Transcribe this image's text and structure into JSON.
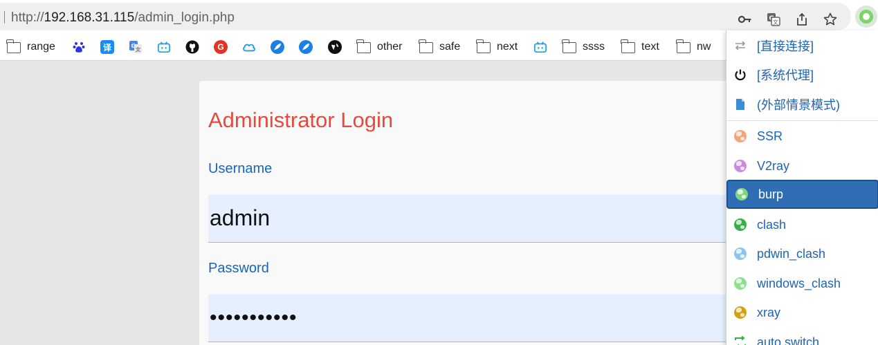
{
  "browser": {
    "url_scheme": "http://",
    "url_host": "192.168.31.115",
    "url_path": "/admin_login.php"
  },
  "bookmarks": [
    {
      "label": "range",
      "icon": "folder-icon"
    },
    {
      "label": "",
      "icon": "baidu-icon"
    },
    {
      "label": "",
      "icon": "translate-icon"
    },
    {
      "label": "",
      "icon": "google-translate-icon"
    },
    {
      "label": "",
      "icon": "bilibili-icon"
    },
    {
      "label": "",
      "icon": "github-icon"
    },
    {
      "label": "",
      "icon": "red-g-icon"
    },
    {
      "label": "",
      "icon": "cloud-icon"
    },
    {
      "label": "",
      "icon": "feather-icon"
    },
    {
      "label": "",
      "icon": "feather-icon"
    },
    {
      "label": "",
      "icon": "globe-icon"
    },
    {
      "label": "other",
      "icon": "folder-icon"
    },
    {
      "label": "safe",
      "icon": "folder-icon"
    },
    {
      "label": "next",
      "icon": "folder-icon"
    },
    {
      "label": "",
      "icon": "bilibili-icon"
    },
    {
      "label": "ssss",
      "icon": "folder-icon"
    },
    {
      "label": "text",
      "icon": "folder-icon"
    },
    {
      "label": "nw",
      "icon": "folder-icon"
    }
  ],
  "page": {
    "title": "Administrator Login",
    "username_label": "Username",
    "username_value": "admin",
    "password_label": "Password",
    "password_masked": "•••••••••••"
  },
  "proxy_menu": {
    "items": [
      {
        "label": "[直接连接]",
        "icon": "direct-arrows-icon"
      },
      {
        "label": "[系统代理]",
        "icon": "power-icon"
      },
      {
        "label": "(外部情景模式)",
        "icon": "file-icon"
      },
      {
        "label": "SSR",
        "icon": "globe-icon",
        "color": "#f4a57a"
      },
      {
        "label": "V2ray",
        "icon": "globe-icon",
        "color": "#c98be0"
      },
      {
        "label": "burp",
        "icon": "globe-icon",
        "color": "#7fd67f",
        "selected": true
      },
      {
        "label": "clash",
        "icon": "globe-icon",
        "color": "#35b04a"
      },
      {
        "label": "pdwin_clash",
        "icon": "globe-icon",
        "color": "#8cc6f0"
      },
      {
        "label": "windows_clash",
        "icon": "globe-icon",
        "color": "#8de08d"
      },
      {
        "label": "xray",
        "icon": "globe-icon",
        "color": "#d4a017"
      },
      {
        "label": "auto switch",
        "icon": "auto-switch-icon",
        "color": "#35b04a"
      }
    ]
  },
  "colors": {
    "title": "#e64a3c",
    "label": "#1565c0",
    "input_bg": "#e6effd",
    "menu_selected": "#2f6db5"
  }
}
